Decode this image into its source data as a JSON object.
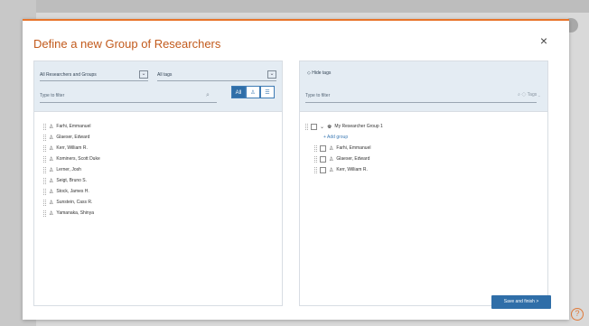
{
  "modal": {
    "title": "Define a new Group of Researchers",
    "close": "×",
    "save_label": "Save and finish  >"
  },
  "left": {
    "group_select": "All Researchers and Groups",
    "tags_select": "All tags",
    "filter_placeholder": "Type to filter",
    "seg": [
      "All",
      "person-icon",
      "group-icon"
    ],
    "researchers": [
      "Farhi, Emmanuel",
      "Glaeser, Edward",
      "Kerr, William R.",
      "Kominers, Scott Duke",
      "Lerner, Josh",
      "Seigt, Bruno S.",
      "Stock, James H.",
      "Sunstein, Cass R.",
      "Yamanaka, Shinya"
    ]
  },
  "right": {
    "hide_tags": "Hide tags",
    "filter_placeholder": "Type to filter",
    "tags_label": "Tags",
    "group_name": "My Researcher Group 1",
    "add_group": "+ Add group",
    "members": [
      "Farhi, Emmanuel",
      "Glaeser, Edward",
      "Kerr, William R."
    ]
  },
  "colors": {
    "accent": "#e8742a",
    "title": "#c25a1c",
    "primary": "#2f6ea8",
    "panel_header": "#e4ecf3"
  }
}
